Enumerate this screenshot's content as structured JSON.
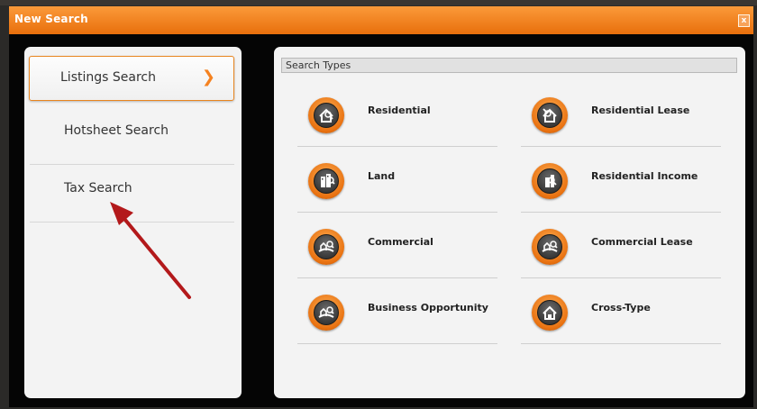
{
  "dialog": {
    "title": "New Search",
    "close_label": "x"
  },
  "nav": {
    "items": [
      {
        "label": "Listings Search",
        "active": true,
        "chevron": "❯"
      },
      {
        "label": "Hotsheet Search",
        "active": false
      },
      {
        "label": "Tax Search",
        "active": false
      }
    ]
  },
  "search_types": {
    "header": "Search Types",
    "items": [
      {
        "label": "Residential",
        "icon": "house-magnifier-icon"
      },
      {
        "label": "Residential Lease",
        "icon": "house-lease-icon"
      },
      {
        "label": "Land",
        "icon": "buildings-icon"
      },
      {
        "label": "Residential Income",
        "icon": "residential-income-icon"
      },
      {
        "label": "Commercial",
        "icon": "commercial-icon"
      },
      {
        "label": "Commercial Lease",
        "icon": "commercial-lease-icon"
      },
      {
        "label": "Business Opportunity",
        "icon": "business-opportunity-icon"
      },
      {
        "label": "Cross-Type",
        "icon": "cross-type-icon"
      }
    ]
  },
  "colors": {
    "accent": "#f58220",
    "titlebar": "#f0842a",
    "annotation_arrow": "#b3191b"
  }
}
